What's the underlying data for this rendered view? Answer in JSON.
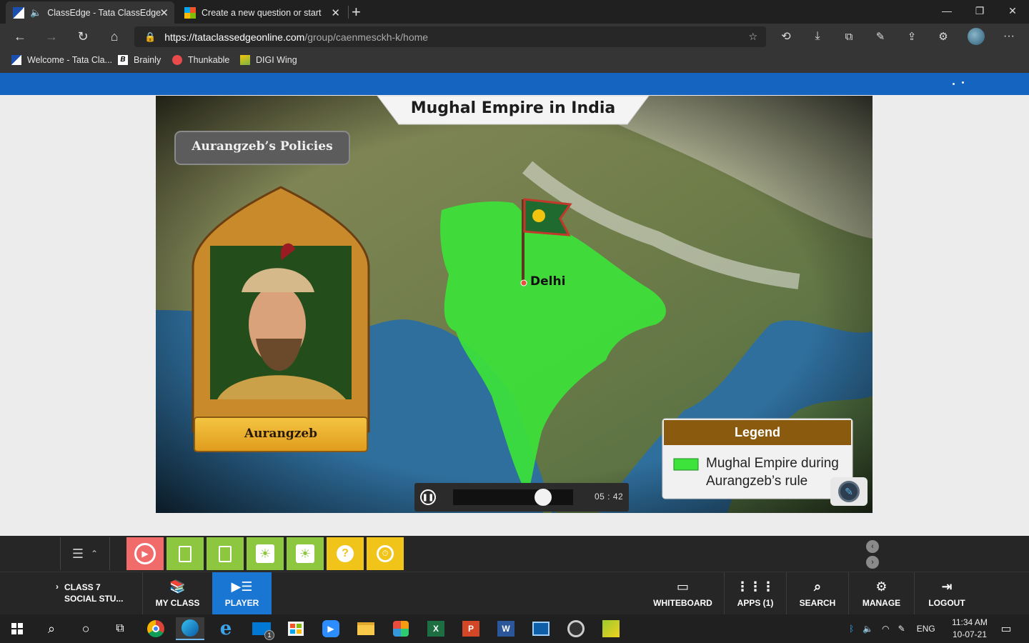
{
  "browser": {
    "tabs": [
      {
        "title": "ClassEdge - Tata ClassEdge",
        "active": true
      },
      {
        "title": "Create a new question or start a",
        "active": false
      }
    ],
    "new_tab": "+",
    "window_controls": {
      "minimize": "—",
      "restore": "❐",
      "close": "✕"
    },
    "url_host": "https://tataclassedgeonline.com",
    "url_path": "/group/caenmesckh-k/home",
    "bookmarks": [
      "Welcome - Tata Cla...",
      "Brainly",
      "Thunkable",
      "DIGI Wing"
    ],
    "menu": "···"
  },
  "slide": {
    "title": "Mughal Empire in India",
    "policies_label": "Aurangzeb’s Policies",
    "portrait_label": "Aurangzeb",
    "city_label": "Delhi",
    "legend_title": "Legend",
    "legend_line1": "Mughal Empire during",
    "legend_line2": "Aurangzeb’s rule",
    "colors": {
      "empire": "#3de23a",
      "legend_header": "#8a5a0f",
      "sea": "#2f6f9e"
    }
  },
  "player": {
    "time": "05 : 42",
    "progress_fraction": 0.75,
    "state": "playing"
  },
  "toolbar_icons": [
    "replay-icon",
    "document-icon",
    "document-icon",
    "bulb-icon",
    "bulb-icon",
    "question-icon",
    "timer-icon"
  ],
  "bottom_nav": {
    "class_line1": "CLASS 7",
    "class_line2": "SOCIAL STU...",
    "my_class": "MY CLASS",
    "player": "PLAYER",
    "whiteboard": "WHITEBOARD",
    "apps": "APPS (1)",
    "search": "SEARCH",
    "manage": "MANAGE",
    "logout": "LOGOUT"
  },
  "taskbar": {
    "mail_badge": "1",
    "language": "ENG",
    "time": "11:34 AM",
    "date": "10-07-21"
  }
}
